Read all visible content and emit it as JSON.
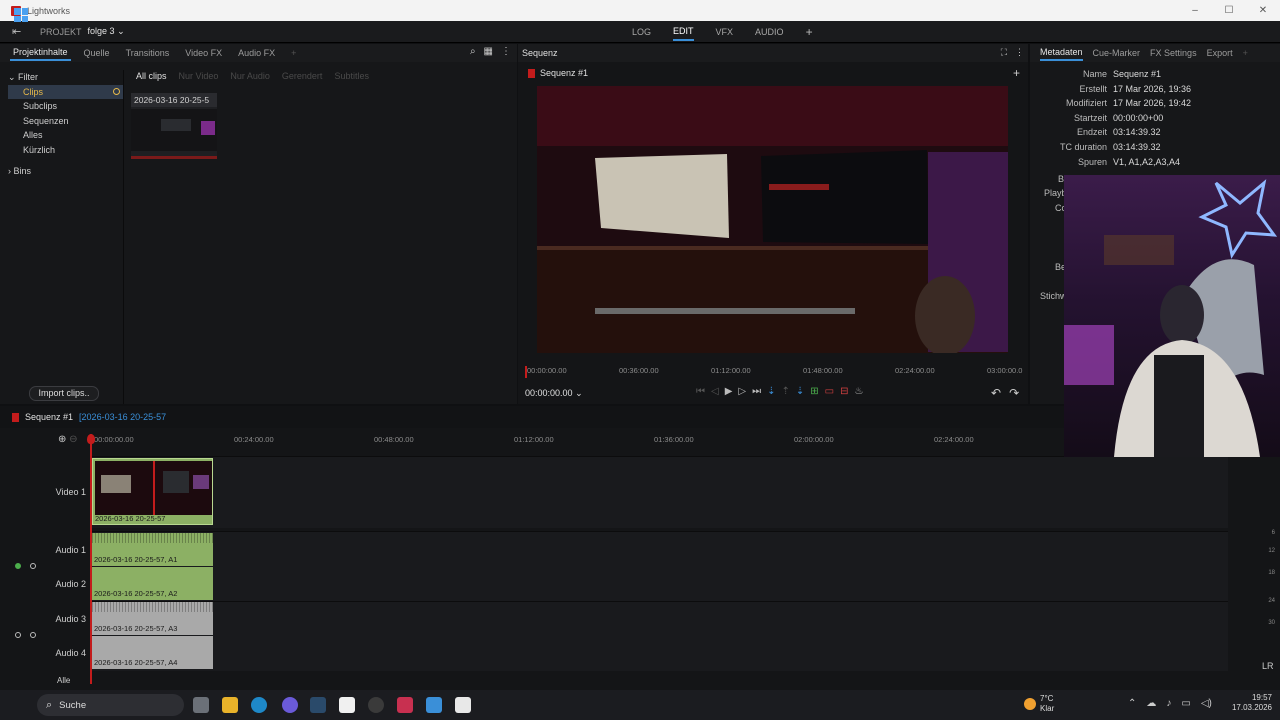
{
  "window": {
    "title": "Lightworks",
    "controls": [
      "–",
      "☐",
      "✕"
    ]
  },
  "project": {
    "label": "PROJEKT",
    "name": "folge 3",
    "chevron": "⌄"
  },
  "modes": {
    "items": [
      "LOG",
      "EDIT",
      "VFX",
      "AUDIO"
    ],
    "active": "EDIT",
    "add": "+"
  },
  "left": {
    "tabs": [
      "Projektinhalte",
      "Quelle",
      "Transitions",
      "Video FX",
      "Audio FX"
    ],
    "tab_add": "+",
    "tree": {
      "filter": "Filter",
      "items": [
        "Clips",
        "Subclips",
        "Sequenzen",
        "Alles",
        "Kürzlich"
      ],
      "bins": "Bins"
    },
    "subtabs": [
      "All clips",
      "Nur Video",
      "Nur Audio",
      "Gerendert",
      "Subtitles"
    ],
    "clip_name": "2026-03-16 20-25-5",
    "import_label": "Import clips.."
  },
  "viewer": {
    "tab": "Sequenz",
    "sequence_name": "Sequenz #1",
    "add": "+",
    "ruler": [
      "00:00:00.00",
      "00:36:00.00",
      "01:12:00.00",
      "01:48:00.00",
      "02:24:00.00",
      "03:00:00.0"
    ],
    "timecode": "00:00:00.00"
  },
  "metadata": {
    "tabs": [
      "Metadaten",
      "Cue-Marker",
      "FX Settings",
      "Export"
    ],
    "add": "+",
    "rows": [
      {
        "k": "Name",
        "v": "Sequenz #1"
      },
      {
        "k": "Erstellt",
        "v": "17 Mar 2026, 19:36"
      },
      {
        "k": "Modifiziert",
        "v": "17 Mar 2026, 19:42"
      },
      {
        "k": "Startzeit",
        "v": "00:00:00+00"
      },
      {
        "k": "Endzeit",
        "v": "03:14:39.32"
      },
      {
        "k": "TC duration",
        "v": "03:14:39.32"
      },
      {
        "k": "Spuren",
        "v": "V1, A1,A2,A3,A4"
      }
    ],
    "partial": [
      "Bi",
      "Playb",
      "Co",
      "Be",
      "Stichw"
    ]
  },
  "timeline": {
    "sequence": "Sequenz #1",
    "clip_ref": "[2026-03-16 20-25-57",
    "ruler": [
      "00:00:00.00",
      "00:24:00.00",
      "00:48:00.00",
      "01:12:00.00",
      "01:36:00.00",
      "02:00:00.00",
      "02:24:00.00"
    ],
    "tracks": {
      "video1": "Video 1",
      "audio1": "Audio 1",
      "audio2": "Audio 2",
      "audio3": "Audio 3",
      "audio4": "Audio 4"
    },
    "clips": {
      "video": "2026-03-16 20-25-57",
      "a1": "2026-03-16 20-25-57, A1",
      "a2": "2026-03-16 20-25-57, A2",
      "a3": "2026-03-16 20-25-57, A3",
      "a4": "2026-03-16 20-25-57, A4"
    },
    "all": "Alle",
    "meter_marks": [
      "6",
      "12",
      "18",
      "24",
      "30"
    ],
    "lr": "LR"
  },
  "taskbar": {
    "search": "Suche",
    "weather_temp": "7°C",
    "weather_desc": "Klar",
    "time": "19:57",
    "date": "17.03.2026",
    "colors": {
      "accent": "#3a8fd8",
      "clip_green": "#8cb064",
      "clip_grey": "#a9a9a9",
      "brand_red": "#c31c1c"
    }
  }
}
